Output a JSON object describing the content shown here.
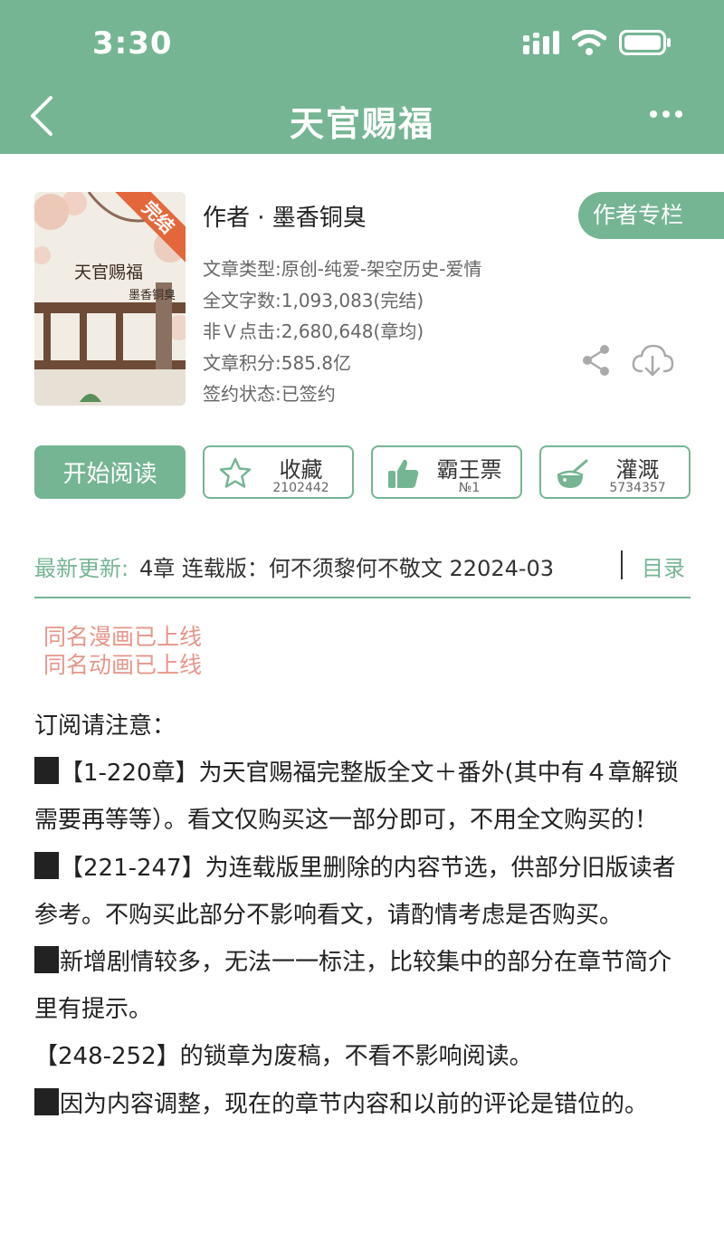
{
  "status_bar": {
    "time": "3:30"
  },
  "nav": {
    "title": "天官赐福"
  },
  "book": {
    "cover_title": "天官赐福",
    "cover_author": "墨香铜臭",
    "cover_badge": "完结",
    "author": "作者 · 墨香铜臭",
    "author_column_label": "作者专栏",
    "meta": [
      "文章类型:原创-纯爱-架空历史-爱情",
      "全文字数:1,093,083(完结)",
      "非Ｖ点击:2,680,648(章均)",
      "文章积分:585.8亿",
      "签约状态:已签约"
    ]
  },
  "actions": {
    "read": "开始阅读",
    "favorite": {
      "label": "收藏",
      "count": "2102442"
    },
    "ticket": {
      "label": "霸王票",
      "count": "№1"
    },
    "water": {
      "label": "灌溉",
      "count": "5734357"
    }
  },
  "update": {
    "label": "最新更新:",
    "text": "4章 连载版：何不须黎何不敬文 22024-03",
    "toc": "目录"
  },
  "notices": [
    "同名漫画已上线",
    "同名动画已上线"
  ],
  "description": {
    "heading": "订阅请注意：",
    "p1": "【1-220章】为天官赐福完整版全文＋番外(其中有４章解锁需要再等等）。看文仅购买这一部分即可，不用全文购买的！",
    "p2": "【221-247】为连载版里删除的内容节选，供部分旧版读者参考。不购买此部分不影响看文，请酌情考虑是否购买。",
    "p3": "新增剧情较多，无法一一标注，比较集中的部分在章节简介里有提示。",
    "p4": "【248-252】的锁章为废稿，不看不影响阅读。",
    "p5": "因为内容调整，现在的章节内容和以前的评论是错位的。"
  },
  "colors": {
    "theme": "#75b594",
    "notice": "#e6968a",
    "badge": "#e2683c"
  }
}
